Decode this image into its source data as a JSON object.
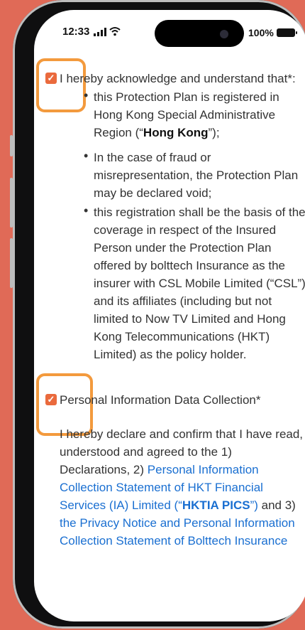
{
  "status": {
    "time": "12:33",
    "battery": "100%"
  },
  "section1": {
    "intro": "I hereby acknowledge and understand that*:",
    "b1_l1": "this Protection Plan is registered in",
    "b1_l2": "Hong Kong Special Administrative",
    "b1_l3_pre": "Region (“",
    "b1_l3_bold": "Hong Kong",
    "b1_l3_post": "”);",
    "b2_l1": "In the case of fraud or",
    "b2_l2": "misrepresentation, the Protection Plan",
    "b2_l3": "may be declared void;",
    "b3_l1": "this registration shall be the basis of the",
    "b3_l2": "coverage in respect of the Insured",
    "b3_l3": "Person under the Protection Plan",
    "b3_l4": "offered by bolttech Insurance as the",
    "b3_l5": "insurer with CSL Mobile Limited (“CSL”)",
    "b3_l6": "and its affiliates (including but not",
    "b3_l7": "limited to Now TV Limited and Hong",
    "b3_l8": "Kong Telecommunications (HKT)",
    "b3_l9": "Limited) as the policy holder."
  },
  "section2": {
    "title": "Personal Information Data Collection*",
    "p_l1": "I hereby declare and confirm that I have read,",
    "p_l2": "understood and agreed to the 1)",
    "p_l3_pre": "Declarations, 2) ",
    "p_l3_link": "Personal Information",
    "p_l4_link": "Collection Statement of HKT Financial",
    "p_l5_link_pre": "Services (IA) Limited (“",
    "p_l5_link_bold": "HKTIA PICS",
    "p_l5_link_post": "”)",
    "p_l5_post": " and 3)",
    "p_l6_link": "the Privacy Notice and Personal Information",
    "p_l7_link": "Collection Statement of Bolttech Insurance"
  },
  "colors": {
    "accent": "#ea6a3d",
    "link": "#1a6fd1",
    "highlight": "#f39a3d",
    "background": "#e06a57"
  },
  "icons": {
    "checkbox": "check-icon",
    "signal": "signal-icon",
    "wifi": "wifi-icon",
    "battery": "battery-icon"
  }
}
